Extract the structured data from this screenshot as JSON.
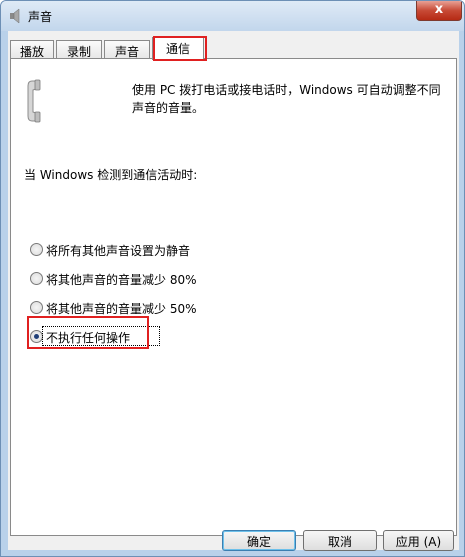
{
  "window": {
    "title": "声音",
    "close_label": "x"
  },
  "tabs": [
    {
      "label": "播放",
      "active": false
    },
    {
      "label": "录制",
      "active": false
    },
    {
      "label": "声音",
      "active": false
    },
    {
      "label": "通信",
      "active": true
    }
  ],
  "panel": {
    "description": "使用 PC 拨打电话或接电话时，Windows 可自动调整不同声音的音量。",
    "detect_label": "当 Windows 检测到通信活动时:",
    "options": [
      {
        "label": "将所有其他声音设置为静音",
        "checked": false
      },
      {
        "label": "将其他声音的音量减少 80%",
        "checked": false
      },
      {
        "label": "将其他声音的音量减少 50%",
        "checked": false
      },
      {
        "label": "不执行任何操作",
        "checked": true
      }
    ]
  },
  "buttons": {
    "ok": "确定",
    "cancel": "取消",
    "apply": "应用 (A)"
  },
  "colors": {
    "highlight": "#e02020",
    "title_bar": "#c2d6ec",
    "radio_dot": "#1f3f78"
  },
  "icons": {
    "title": "speaker-icon",
    "panel": "telephone-handset-icon"
  }
}
